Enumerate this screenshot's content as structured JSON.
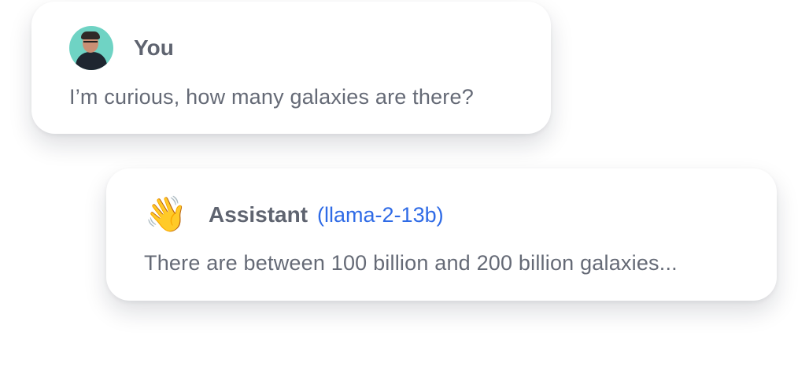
{
  "conversation": {
    "user_message": {
      "author": "You",
      "avatar": "user-photo-avatar",
      "text": "I’m curious, how many galaxies are there?"
    },
    "assistant_message": {
      "author": "Assistant",
      "icon": "waving-hand-icon",
      "emoji": "👋",
      "model": "(llama-2-13b)",
      "text": "There are between 100 billion and 200 billion galaxies..."
    }
  },
  "colors": {
    "name_text": "#5f6470",
    "message_text": "#656a76",
    "model_link": "#2f6be6",
    "avatar_bg": "#6fd3c4"
  }
}
